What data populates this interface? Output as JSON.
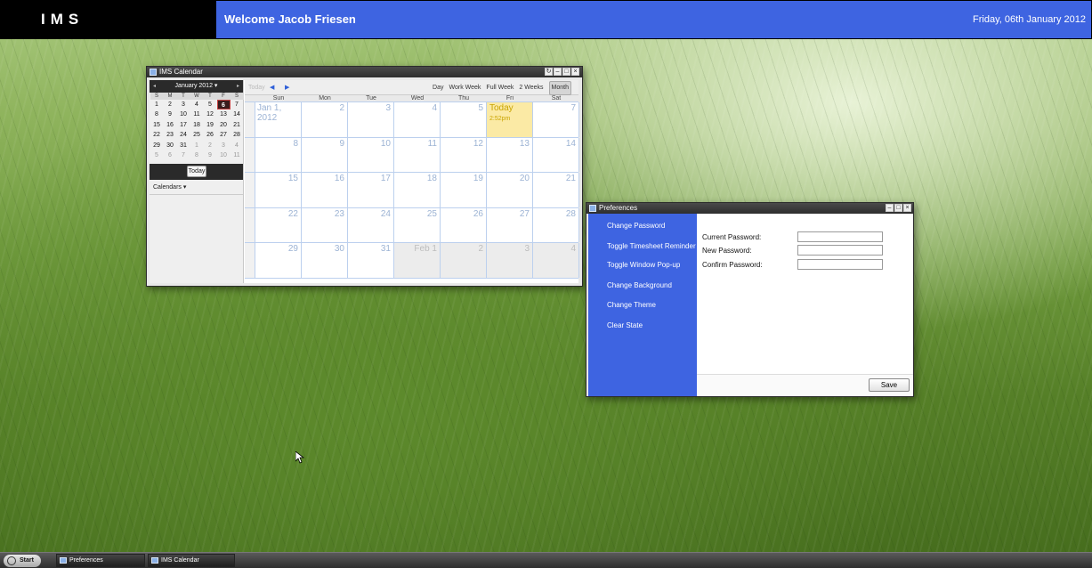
{
  "header": {
    "logo": "IMS",
    "welcome": "Welcome Jacob Friesen",
    "date": "Friday, 06th January 2012"
  },
  "calendar_window": {
    "title": "IMS Calendar",
    "mini": {
      "month_label": "January 2012 ▾",
      "prev": "◂",
      "next": "▸",
      "day_headers": [
        "S",
        "M",
        "T",
        "W",
        "T",
        "F",
        "S"
      ],
      "weeks": [
        [
          "1",
          "2",
          "3",
          "4",
          "5",
          "6",
          "7"
        ],
        [
          "8",
          "9",
          "10",
          "11",
          "12",
          "13",
          "14"
        ],
        [
          "15",
          "16",
          "17",
          "18",
          "19",
          "20",
          "21"
        ],
        [
          "22",
          "23",
          "24",
          "25",
          "26",
          "27",
          "28"
        ],
        [
          "29",
          "30",
          "31",
          "1",
          "2",
          "3",
          "4"
        ],
        [
          "5",
          "6",
          "7",
          "8",
          "9",
          "10",
          "11"
        ]
      ],
      "selected_day": "6",
      "today_button": "Today",
      "calendars_label": "Calendars ▾"
    },
    "toolbar": {
      "today": "Today",
      "prev": "◀",
      "next": "▶",
      "views": [
        "Day",
        "Work Week",
        "Full Week",
        "2 Weeks",
        "Month"
      ],
      "active_view": "Month"
    },
    "day_names": [
      "Sun",
      "Mon",
      "Tue",
      "Wed",
      "Thu",
      "Fri",
      "Sat"
    ],
    "month_weeks": [
      [
        "Jan 1, 2012",
        "2",
        "3",
        "4",
        "5",
        "Today",
        "7"
      ],
      [
        "8",
        "9",
        "10",
        "11",
        "12",
        "13",
        "14"
      ],
      [
        "15",
        "16",
        "17",
        "18",
        "19",
        "20",
        "21"
      ],
      [
        "22",
        "23",
        "24",
        "25",
        "26",
        "27",
        "28"
      ],
      [
        "29",
        "30",
        "31",
        "Feb 1",
        "2",
        "3",
        "4"
      ]
    ],
    "today_time": "2:52pm"
  },
  "preferences_window": {
    "title": "Preferences",
    "menu": [
      "Change Password",
      "Toggle Timesheet Reminder",
      "Toggle Window Pop-up",
      "Change Background",
      "Change Theme",
      "Clear State"
    ],
    "fields": {
      "current_password": {
        "label": "Current Password:",
        "value": ""
      },
      "new_password": {
        "label": "New Password:",
        "value": ""
      },
      "confirm_password": {
        "label": "Confirm Password:",
        "value": ""
      }
    },
    "save_label": "Save"
  },
  "taskbar": {
    "start_label": "Start",
    "tasks": [
      "Preferences",
      "IMS Calendar"
    ]
  },
  "colors": {
    "accent": "#3e64e1",
    "header_bg": "#000000",
    "today_cell": "#fbeaa5"
  }
}
